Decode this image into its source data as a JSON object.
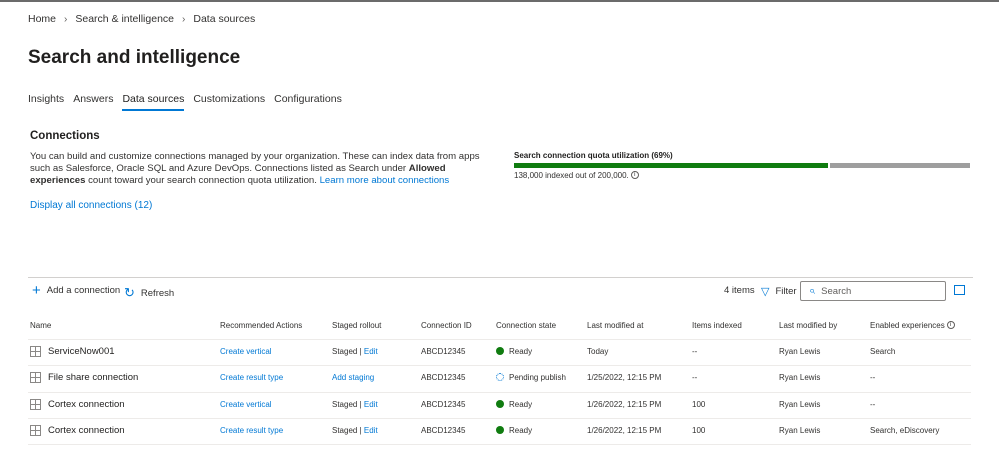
{
  "breadcrumb": [
    "Home",
    "Search & intelligence",
    "Data sources"
  ],
  "page_title": "Search and intelligence",
  "tabs": [
    "Insights",
    "Answers",
    "Data sources",
    "Customizations",
    "Configurations"
  ],
  "active_tab": "Data sources",
  "connections": {
    "heading": "Connections",
    "desc_1": "You can build and customize connections managed by your organization. These can index data from apps such as Salesforce, Oracle SQL and Azure DevOps. Connections listed as Search under ",
    "desc_bold": "Allowed experiences",
    "desc_2": " count toward your search connection quota utilization. ",
    "learn_more": "Learn more about connections",
    "display_all": "Display all connections (12)"
  },
  "quota": {
    "label": "Search connection quota utilization (69%)",
    "percent": 69,
    "text": "138,000 indexed out of 200,000.",
    "info": "i"
  },
  "toolbar": {
    "add": "Add a connection",
    "refresh": "Refresh",
    "count": "4 items",
    "filter": "Filter",
    "search_placeholder": "Search"
  },
  "columns": [
    "Name",
    "Recommended Actions",
    "Staged rollout",
    "Connection ID",
    "Connection state",
    "Last modified at",
    "Items indexed",
    "Last modified by",
    "Enabled experiences"
  ],
  "rows": [
    {
      "name": "ServiceNow001",
      "action": "Create vertical",
      "staged": "Staged | ",
      "staged_link": "Edit",
      "id": "ABCD12345",
      "state": "Ready",
      "state_kind": "ready",
      "modified": "Today",
      "items": "--",
      "by": "Ryan Lewis",
      "exp": "Search"
    },
    {
      "name": "File share connection",
      "action": "Create result type",
      "staged": "",
      "staged_link": "Add staging",
      "id": "ABCD12345",
      "state": "Pending publish",
      "state_kind": "pending",
      "modified": "1/25/2022, 12:15 PM",
      "items": "--",
      "by": "Ryan Lewis",
      "exp": "--"
    },
    {
      "name": "Cortex connection",
      "action": "Create vertical",
      "staged": "Staged | ",
      "staged_link": "Edit",
      "id": "ABCD12345",
      "state": "Ready",
      "state_kind": "ready",
      "modified": "1/26/2022, 12:15 PM",
      "items": "100",
      "by": "Ryan Lewis",
      "exp": "--"
    },
    {
      "name": "Cortex connection",
      "action": "Create result type",
      "staged": "Staged | ",
      "staged_link": "Edit",
      "id": "ABCD12345",
      "state": "Ready",
      "state_kind": "ready",
      "modified": "1/26/2022, 12:15 PM",
      "items": "100",
      "by": "Ryan Lewis",
      "exp": "Search, eDiscovery"
    }
  ],
  "colors": {
    "accent": "#0078d4",
    "success": "#107c10",
    "quota_rest": "#9e9e9e"
  }
}
